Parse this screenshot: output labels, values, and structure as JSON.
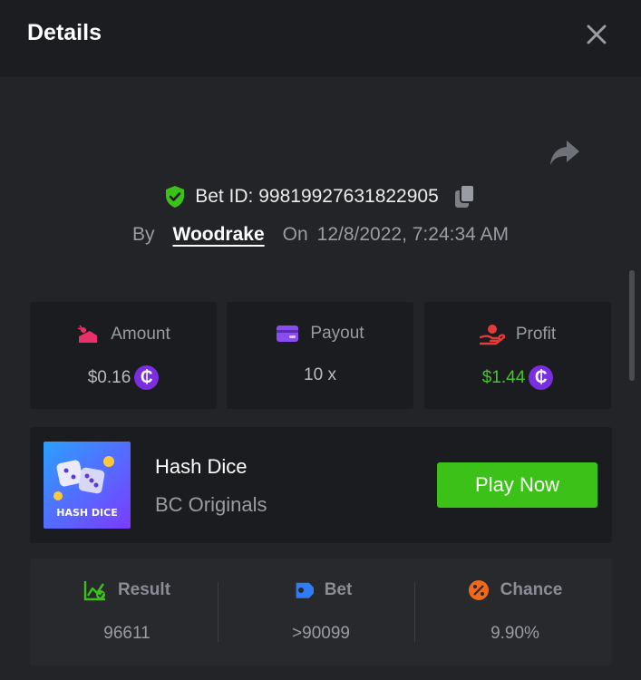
{
  "header": {
    "title": "Details"
  },
  "bet": {
    "id_label": "Bet ID: 99819927631822905",
    "by_label": "By",
    "username": "Woodrake",
    "on_label": "On",
    "datetime": "12/8/2022, 7:24:34 AM"
  },
  "stats": {
    "amount_label": "Amount",
    "amount_value": "$0.16",
    "payout_label": "Payout",
    "payout_value": "10 x",
    "profit_label": "Profit",
    "profit_value": "$1.44",
    "coin_symbol": "₵"
  },
  "game": {
    "name": "Hash Dice",
    "provider": "BC Originals",
    "thumb_text": "HASH DICE",
    "play_label": "Play Now"
  },
  "result": {
    "result_label": "Result",
    "result_value": "96611",
    "bet_label": "Bet",
    "bet_value": ">90099",
    "chance_label": "Chance",
    "chance_value": "9.90%"
  },
  "colors": {
    "accent_green": "#3bc117",
    "profit_green": "#44c729",
    "coin_purple": "#7a2ee0"
  },
  "icons": [
    "close-icon",
    "share-icon",
    "shield-check-icon",
    "copy-icon",
    "amount-icon",
    "payout-icon",
    "profit-icon",
    "result-chart-icon",
    "bet-tag-icon",
    "percent-icon"
  ]
}
